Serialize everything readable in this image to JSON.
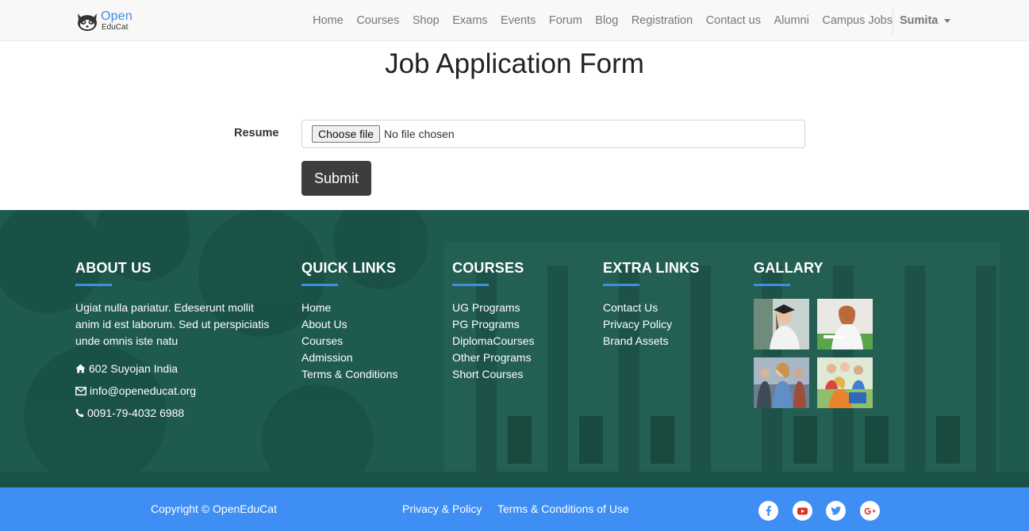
{
  "brand": {
    "logo_top": "Open",
    "logo_bottom": "EduCat"
  },
  "nav": {
    "items": [
      "Home",
      "Courses",
      "Shop",
      "Exams",
      "Events",
      "Forum",
      "Blog",
      "Registration",
      "Contact us",
      "Alumni",
      "Campus Jobs"
    ],
    "user": "Sumita"
  },
  "form": {
    "title": "Job Application Form",
    "resume_label": "Resume",
    "choose_file": "Choose file",
    "no_file": "No file chosen",
    "submit": "Submit"
  },
  "footer": {
    "about": {
      "heading": "ABOUT US",
      "text": "Ugiat nulla pariatur. Edeserunt mollit anim id est laborum. Sed ut perspiciatis unde omnis iste natu",
      "address": "602 Suyojan India",
      "email": "info@openeducat.org",
      "phone": "0091-79-4032 6988"
    },
    "quick_links": {
      "heading": "QUICK LINKS",
      "items": [
        "Home",
        "About Us",
        "Courses",
        "Admission",
        "Terms & Conditions"
      ]
    },
    "courses": {
      "heading": "COURSES",
      "items": [
        "UG Programs",
        "PG Programs",
        "DiplomaCourses",
        "Other Programs",
        "Short Courses"
      ]
    },
    "extra_links": {
      "heading": "EXTRA LINKS",
      "items": [
        "Contact Us",
        "Privacy Policy",
        "Brand Assets"
      ]
    },
    "gallery": {
      "heading": "GALLARY"
    }
  },
  "bottom": {
    "copyright": "Copyright © OpenEduCat",
    "privacy": "Privacy & Policy",
    "terms": "Terms & Conditions of Use",
    "social": [
      "facebook-icon",
      "youtube-icon",
      "twitter-icon",
      "google-plus-icon"
    ]
  },
  "colors": {
    "footer_bg": "#1f5a4e",
    "accent": "#3f8ef3",
    "submit_bg": "#3d3d3d",
    "logo_blue": "#3f8ee0"
  }
}
